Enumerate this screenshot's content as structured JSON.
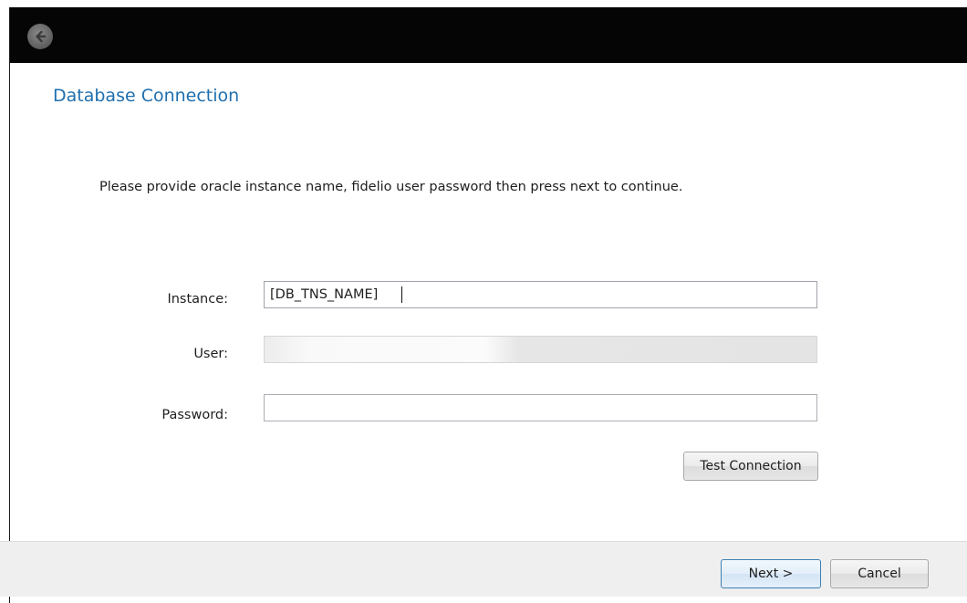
{
  "window": {
    "back_icon": "back-arrow-icon"
  },
  "page": {
    "title": "Database Connection",
    "instructions": "Please provide oracle instance name, fidelio user password then press next to continue."
  },
  "form": {
    "instance_label": "Instance:",
    "instance_value": "[DB_TNS_NAME]",
    "user_label": "User:",
    "user_value": "",
    "password_label": "Password:",
    "password_value": ""
  },
  "buttons": {
    "test_connection": "Test Connection",
    "next": "Next >",
    "cancel": "Cancel"
  },
  "colors": {
    "title": "#1f6fae",
    "titlebar": "#050505",
    "footer": "#efefef"
  }
}
